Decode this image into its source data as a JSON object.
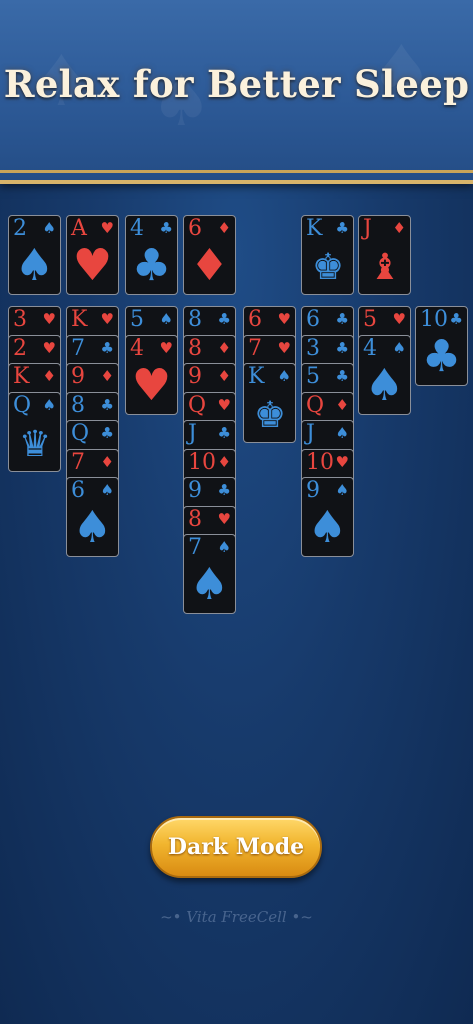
{
  "banner": {
    "title": "Relax for Better Sleep"
  },
  "button": {
    "label": "Dark Mode"
  },
  "footer": {
    "logo": "~• Vita FreeCell •~"
  },
  "colors": {
    "red_suit": "#e8463f",
    "black_suit": "#3d8ed9",
    "button_gold": "#f1b52e"
  },
  "free_cells": [
    {
      "rank": "2",
      "suit": "♠",
      "color": "blue"
    },
    {
      "rank": "A",
      "suit": "♥",
      "color": "red"
    },
    {
      "rank": "4",
      "suit": "♣",
      "color": "blue"
    },
    {
      "rank": "6",
      "suit": "♦",
      "color": "red"
    }
  ],
  "foundations": [
    {
      "rank": "K",
      "suit": "♣",
      "color": "blue",
      "face": "king"
    },
    {
      "rank": "J",
      "suit": "♦",
      "color": "red",
      "face": "jack"
    }
  ],
  "tableau": [
    [
      {
        "rank": "3",
        "suit": "♥",
        "color": "red"
      },
      {
        "rank": "2",
        "suit": "♥",
        "color": "red"
      },
      {
        "rank": "K",
        "suit": "♦",
        "color": "red"
      },
      {
        "rank": "Q",
        "suit": "♠",
        "color": "blue",
        "face": "queen"
      }
    ],
    [
      {
        "rank": "K",
        "suit": "♥",
        "color": "red"
      },
      {
        "rank": "7",
        "suit": "♣",
        "color": "blue"
      },
      {
        "rank": "9",
        "suit": "♦",
        "color": "red"
      },
      {
        "rank": "8",
        "suit": "♣",
        "color": "blue"
      },
      {
        "rank": "Q",
        "suit": "♣",
        "color": "blue"
      },
      {
        "rank": "7",
        "suit": "♦",
        "color": "red"
      },
      {
        "rank": "6",
        "suit": "♠",
        "color": "blue"
      }
    ],
    [
      {
        "rank": "5",
        "suit": "♠",
        "color": "blue"
      },
      {
        "rank": "4",
        "suit": "♥",
        "color": "red"
      }
    ],
    [
      {
        "rank": "8",
        "suit": "♣",
        "color": "blue"
      },
      {
        "rank": "8",
        "suit": "♦",
        "color": "red"
      },
      {
        "rank": "9",
        "suit": "♦",
        "color": "red"
      },
      {
        "rank": "Q",
        "suit": "♥",
        "color": "red"
      },
      {
        "rank": "J",
        "suit": "♣",
        "color": "blue"
      },
      {
        "rank": "10",
        "suit": "♦",
        "color": "red"
      },
      {
        "rank": "9",
        "suit": "♣",
        "color": "blue"
      },
      {
        "rank": "8",
        "suit": "♥",
        "color": "red"
      },
      {
        "rank": "7",
        "suit": "♠",
        "color": "blue"
      }
    ],
    [
      {
        "rank": "6",
        "suit": "♥",
        "color": "red"
      },
      {
        "rank": "7",
        "suit": "♥",
        "color": "red"
      },
      {
        "rank": "K",
        "suit": "♠",
        "color": "blue",
        "face": "king"
      }
    ],
    [
      {
        "rank": "6",
        "suit": "♣",
        "color": "blue"
      },
      {
        "rank": "3",
        "suit": "♣",
        "color": "blue"
      },
      {
        "rank": "5",
        "suit": "♣",
        "color": "blue"
      },
      {
        "rank": "Q",
        "suit": "♦",
        "color": "red"
      },
      {
        "rank": "J",
        "suit": "♠",
        "color": "blue"
      },
      {
        "rank": "10",
        "suit": "♥",
        "color": "red"
      },
      {
        "rank": "9",
        "suit": "♠",
        "color": "blue"
      }
    ],
    [
      {
        "rank": "5",
        "suit": "♥",
        "color": "red"
      },
      {
        "rank": "4",
        "suit": "♠",
        "color": "blue"
      }
    ],
    [
      {
        "rank": "10",
        "suit": "♣",
        "color": "blue"
      }
    ]
  ]
}
